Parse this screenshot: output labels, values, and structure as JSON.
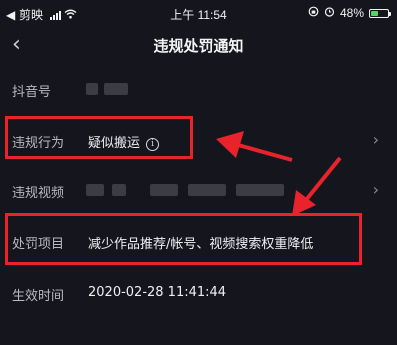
{
  "status_bar": {
    "back_app": "◀ 剪映",
    "time": "上午 11:54",
    "battery": "48%",
    "battery_level": 0.48
  },
  "nav": {
    "title": "违规处罚通知"
  },
  "rows": {
    "douyin_id": {
      "label": "抖音号"
    },
    "violation": {
      "label": "违规行为",
      "value": "疑似搬运"
    },
    "video": {
      "label": "违规视频"
    },
    "penalty": {
      "label": "处罚项目",
      "value": "减少作品推荐/帐号、视频搜索权重降低"
    },
    "effective": {
      "label": "生效时间",
      "value": "2020-02-28 11:41:44"
    }
  },
  "colors": {
    "background": "#15161d",
    "highlight": "#e8232b"
  }
}
